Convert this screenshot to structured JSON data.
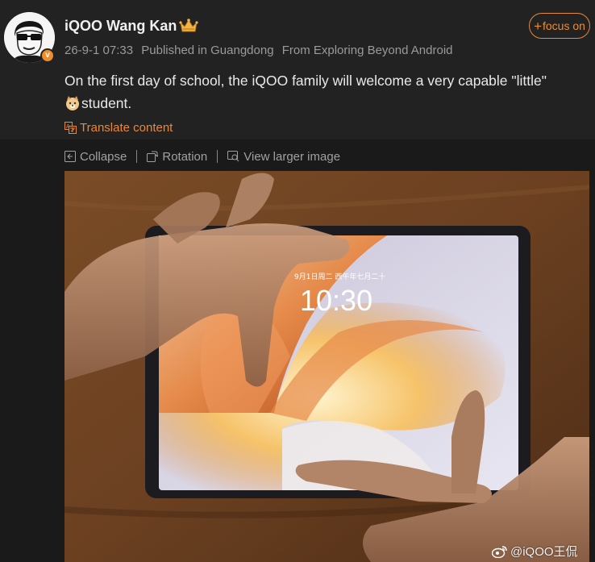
{
  "post": {
    "username": "iQOO Wang Kan",
    "follow_label": "focus on",
    "follow_symbol": "+",
    "date": "26-9-1 07:33",
    "location": "Published in Guangdong",
    "source": "From Exploring Beyond Android",
    "text_part1": "On the first day of school, the iQOO family will welcome a very capable \"little\"",
    "text_part2": "student.",
    "translate_label": "Translate content",
    "verified_badge": "v"
  },
  "toolbar": {
    "collapse_label": "Collapse",
    "rotation_label": "Rotation",
    "view_larger_label": "View larger image"
  },
  "photo": {
    "screen_date": "9月1日周二 西午年七月二十",
    "screen_time": "10:30",
    "watermark": "@iQOO王侃"
  },
  "colors": {
    "accent": "#f08d2a",
    "background": "#1c1c1c",
    "text": "#e9e9e9",
    "muted": "#9a9a9a"
  },
  "icons": [
    "crown-icon",
    "verified-badge-icon",
    "emoji-dog-icon",
    "translate-icon",
    "collapse-icon",
    "rotation-icon",
    "view-larger-icon",
    "weibo-logo-icon"
  ]
}
